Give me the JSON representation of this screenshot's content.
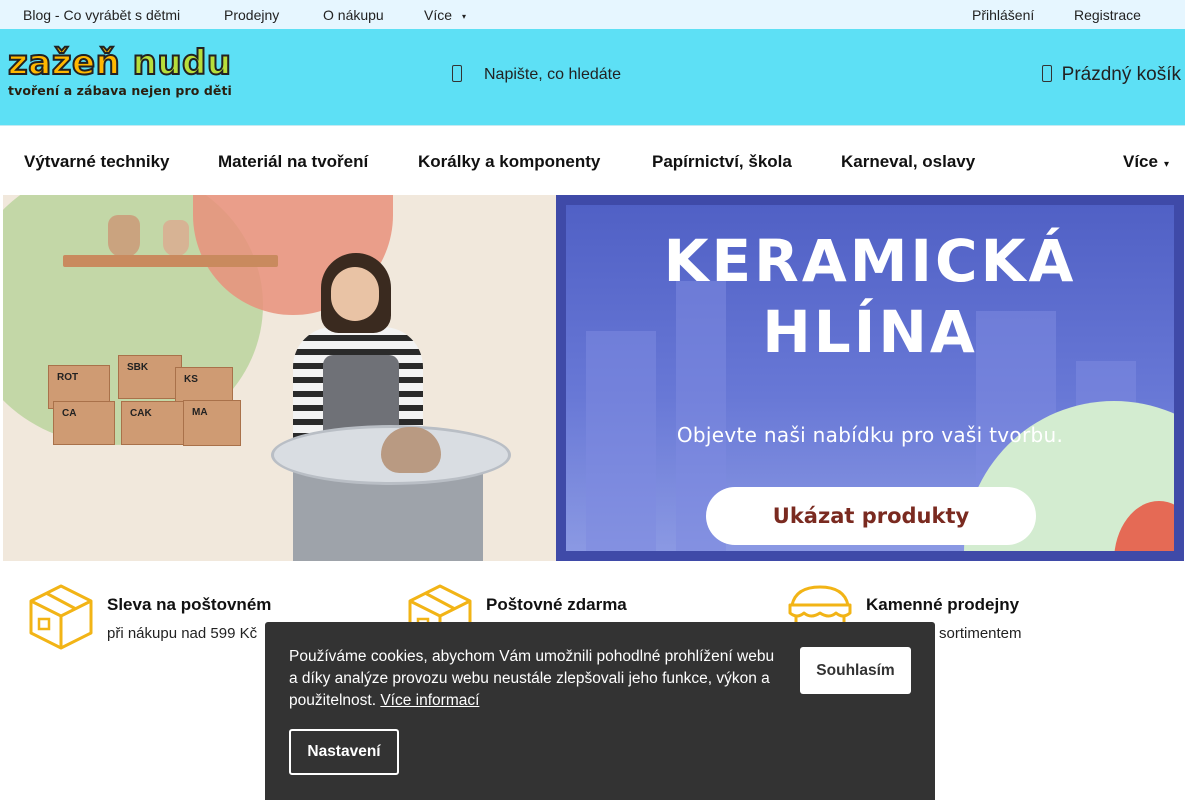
{
  "topbar": {
    "links": [
      "Blog - Co vyrábět s dětmi",
      "Prodejny",
      "O nákupu",
      "Více"
    ],
    "login": "Přihlášení",
    "register": "Registrace"
  },
  "header": {
    "logo_main_a": "zažeň",
    "logo_main_b": "nudu",
    "logo_tagline": "tvoření a zábava nejen pro děti",
    "search_placeholder": "Napište, co hledáte",
    "cart_label": "Prázdný košík"
  },
  "nav": {
    "items": [
      "Výtvarné techniky",
      "Materiál na tvoření",
      "Korálky a komponenty",
      "Papírnictví, škola",
      "Karneval, oslavy"
    ],
    "more": "Více"
  },
  "hero": {
    "title_line1": "KERAMICKÁ",
    "title_line2": "HLÍNA",
    "subtitle": "Objevte naši nabídku pro vaši tvorbu.",
    "button": "Ukázat produkty",
    "clay_labels": [
      "ROT",
      "SBK",
      "KS",
      "CA",
      "CAK",
      "MA"
    ]
  },
  "benefits": [
    {
      "title": "Sleva na poštovném",
      "desc": "při nákupu nad 599 Kč",
      "icon": "box-icon"
    },
    {
      "title": "Poštovné zdarma",
      "desc": "",
      "icon": "box-icon"
    },
    {
      "title": "Kamenné prodejny",
      "desc": "sortimentem",
      "icon": "store-icon"
    }
  ],
  "cookie": {
    "text": "Používáme cookies, abychom Vám umožnili pohodlné prohlížení webu a díky analýze provozu webu neustále zlepšovali jeho funkce, výkon a použitelnost.",
    "link": "Více informací",
    "accept": "Souhlasím",
    "settings": "Nastavení"
  },
  "colors": {
    "header_bg": "#5de0f5",
    "topbar_bg": "#e6f6ff",
    "icon_accent": "#f2b416",
    "cookie_bg": "#333333"
  }
}
